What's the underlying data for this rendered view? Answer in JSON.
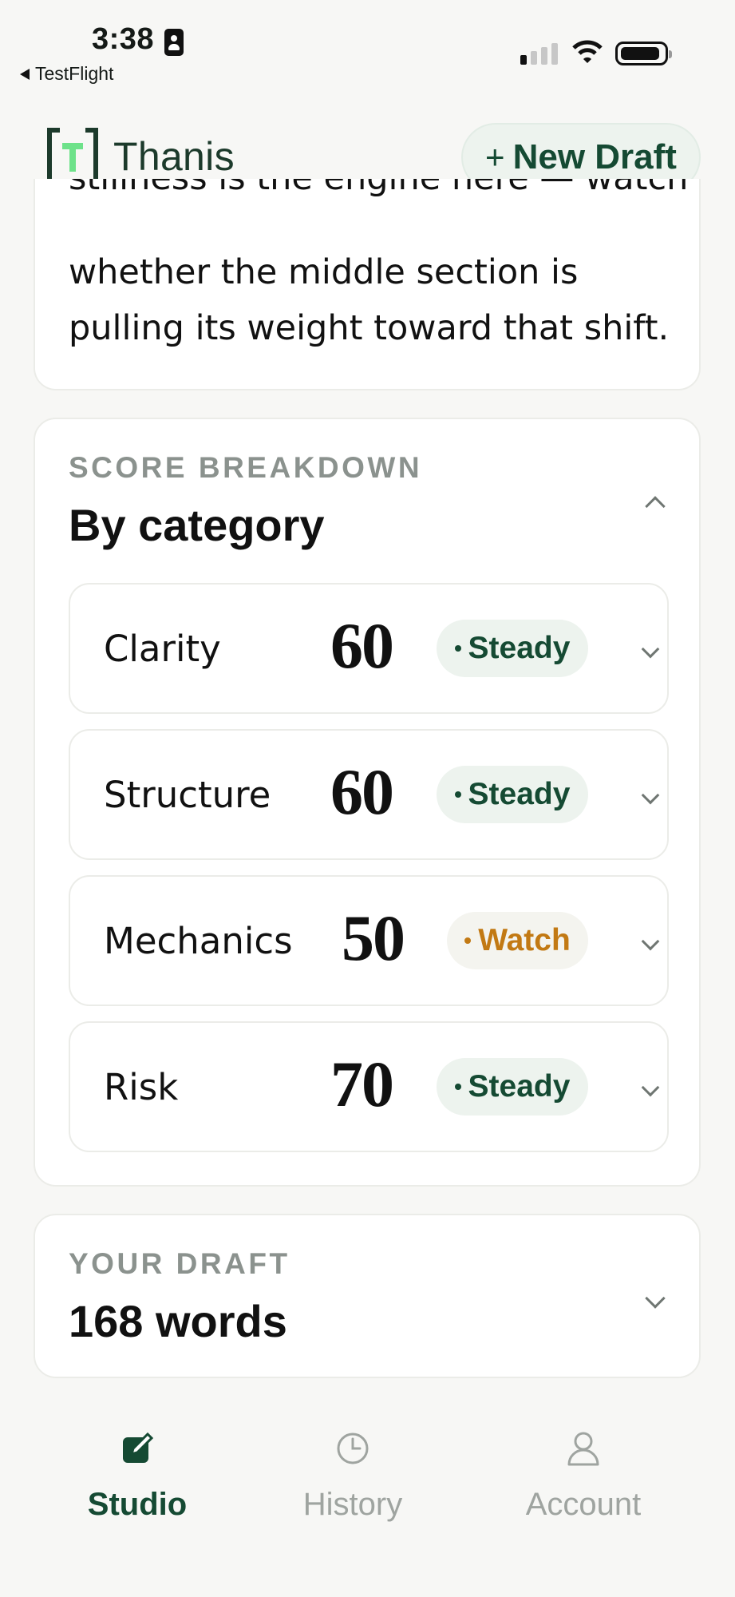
{
  "status": {
    "time": "3:38",
    "back_app": "TestFlight"
  },
  "header": {
    "brand": "Thanis",
    "new_draft_label": "New Draft"
  },
  "analysis_card": {
    "lines": [
      "stillness is the engine here — watch",
      "whether the middle section is",
      "pulling its weight toward that shift."
    ]
  },
  "score_breakdown": {
    "kicker": "SCORE BREAKDOWN",
    "title": "By category",
    "items": [
      {
        "name": "Clarity",
        "score": "60",
        "status": "Steady",
        "status_color": "#154a33"
      },
      {
        "name": "Structure",
        "score": "60",
        "status": "Steady",
        "status_color": "#154a33"
      },
      {
        "name": "Mechanics",
        "score": "50",
        "status": "Watch",
        "status_color": "#c27913"
      },
      {
        "name": "Risk",
        "score": "70",
        "status": "Steady",
        "status_color": "#154a33"
      }
    ]
  },
  "draft": {
    "kicker": "YOUR DRAFT",
    "title": "168 words"
  },
  "nav": {
    "items": [
      {
        "label": "Studio",
        "icon": "pen-square-icon",
        "active": true
      },
      {
        "label": "History",
        "icon": "clock-icon",
        "active": false
      },
      {
        "label": "Account",
        "icon": "person-icon",
        "active": false
      }
    ]
  },
  "colors": {
    "accent": "#154a33",
    "brand_green": "#6ee28a",
    "watch": "#c27913"
  }
}
